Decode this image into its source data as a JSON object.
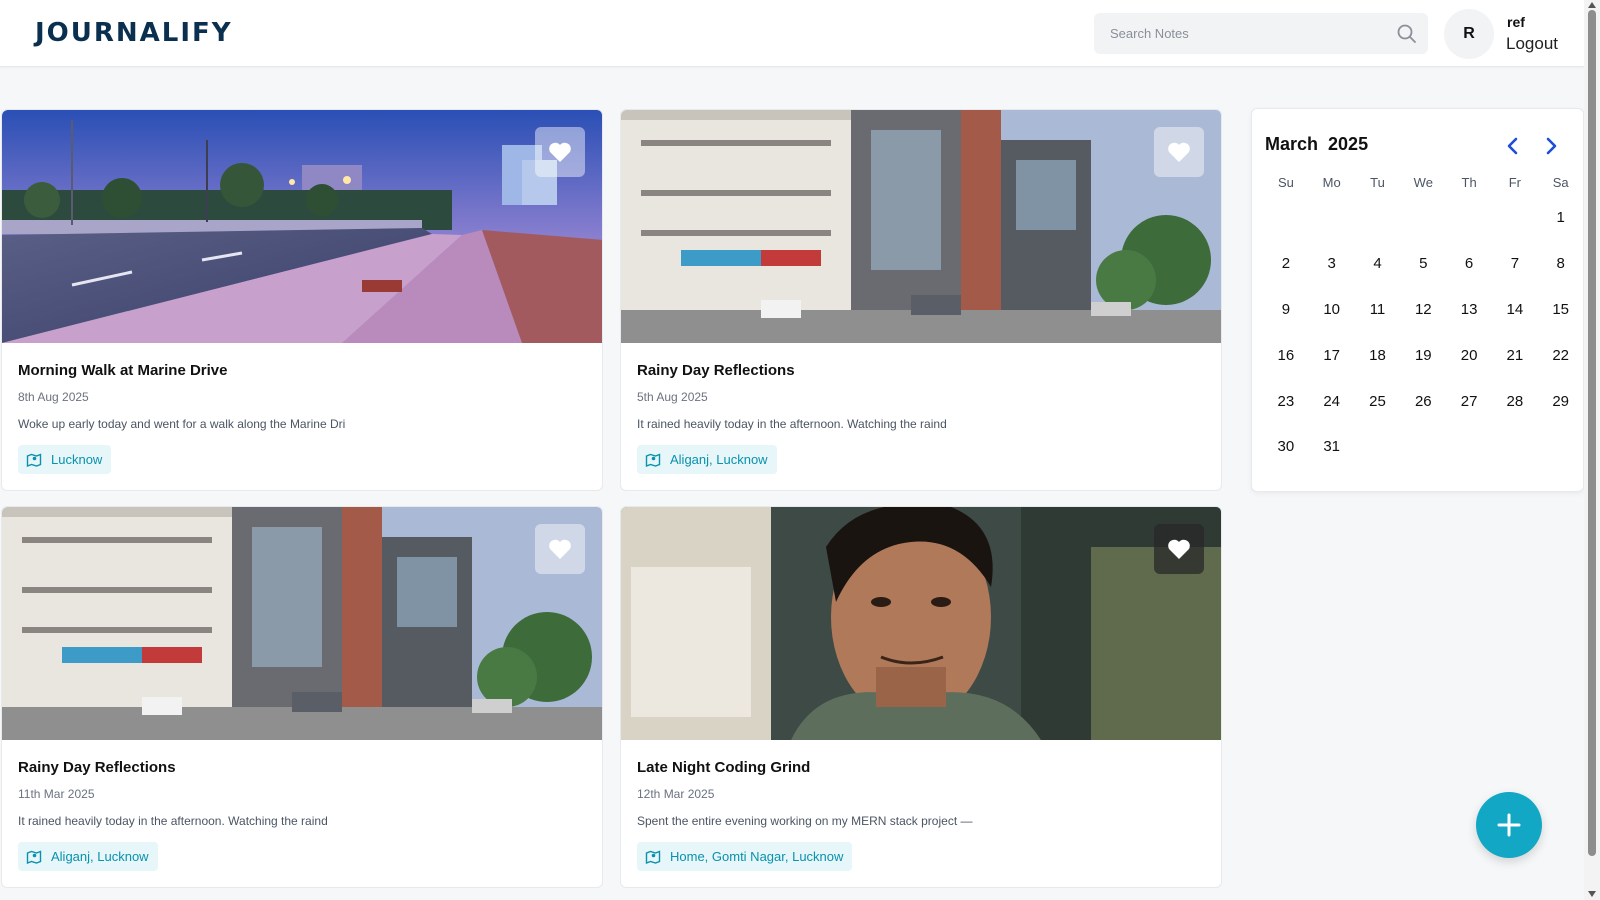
{
  "app": {
    "logo": "JOURNALIFY"
  },
  "header": {
    "search_placeholder": "Search Notes",
    "avatar_initial": "R",
    "user_name": "ref",
    "logout_label": "Logout"
  },
  "cards": [
    {
      "title": "Morning Walk at Marine Drive",
      "date": "8th Aug 2025",
      "excerpt": "Woke up early today and went for a walk along the Marine Dri",
      "location": "Lucknow",
      "image": "promenade-dusk"
    },
    {
      "title": "Rainy Day Reflections",
      "date": "5th Aug 2025",
      "excerpt": "It rained heavily today in the afternoon. Watching the raind",
      "location": "Aliganj, Lucknow",
      "image": "street-shops"
    },
    {
      "title": "Rainy Day Reflections",
      "date": "11th Mar 2025",
      "excerpt": "It rained heavily today in the afternoon. Watching the raind",
      "location": "Aliganj, Lucknow",
      "image": "street-shops"
    },
    {
      "title": "Late Night Coding Grind",
      "date": "12th Mar 2025",
      "excerpt": "Spent the entire evening working on my MERN stack project —",
      "location": "Home, Gomti Nagar, Lucknow",
      "image": "portrait"
    }
  ],
  "calendar": {
    "month": "March",
    "year": "2025",
    "weekdays": [
      "Su",
      "Mo",
      "Tu",
      "We",
      "Th",
      "Fr",
      "Sa"
    ],
    "leading_blanks": 6,
    "days": [
      "1",
      "2",
      "3",
      "4",
      "5",
      "6",
      "7",
      "8",
      "9",
      "10",
      "11",
      "12",
      "13",
      "14",
      "15",
      "16",
      "17",
      "18",
      "19",
      "20",
      "21",
      "22",
      "23",
      "24",
      "25",
      "26",
      "27",
      "28",
      "29",
      "30",
      "31"
    ]
  },
  "icons": {
    "search": "search-icon",
    "favorite": "heart-icon",
    "location": "map-icon",
    "prev": "chevron-left-icon",
    "next": "chevron-right-icon",
    "add": "plus-icon"
  },
  "colors": {
    "accent": "#12a7c4",
    "chip_bg": "#e6f6f9",
    "chip_text": "#0a91ad",
    "calendar_nav": "#1d4ed8",
    "logo": "#0b2f4f"
  }
}
